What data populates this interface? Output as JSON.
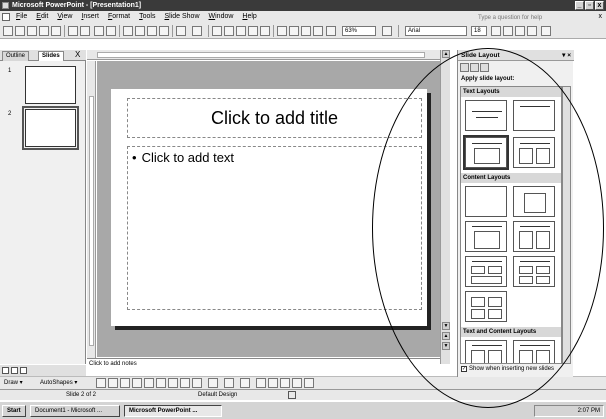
{
  "window": {
    "title": "Microsoft PowerPoint - [Presentation1]",
    "buttons": [
      "_",
      "▫",
      "x"
    ]
  },
  "menubar": {
    "items": [
      "File",
      "Edit",
      "View",
      "Insert",
      "Format",
      "Tools",
      "Slide Show",
      "Window",
      "Help"
    ],
    "ask_placeholder": "Type a question for help",
    "close": "x"
  },
  "toolbar": {
    "zoom": "63%",
    "font": "Arial",
    "font_size": "18"
  },
  "panel_tabs": {
    "outline": "Outline",
    "slides": "Slides",
    "close": "X"
  },
  "thumbnails": [
    {
      "num": "1"
    },
    {
      "num": "2"
    }
  ],
  "slide": {
    "title_placeholder": "Click to add title",
    "body_placeholder": "Click to add text",
    "bullet": "•"
  },
  "notes": {
    "placeholder": "Click to add notes"
  },
  "drawing_toolbar": {
    "draw": "Draw ▾",
    "autoshapes": "AutoShapes ▾"
  },
  "statusbar": {
    "slide": "Slide 2 of 2",
    "design": "Default Design"
  },
  "taskbar": {
    "start": "Start",
    "tasks": [
      "Document1 - Microsoft ...",
      "Microsoft PowerPoint ..."
    ],
    "clock": "2:07 PM"
  },
  "taskpane": {
    "title": "Slide Layout",
    "apply_label": "Apply slide layout:",
    "sections": [
      "Text Layouts",
      "Content Layouts",
      "Text and Content Layouts"
    ],
    "checkbox_label": "Show when inserting new slides",
    "checkbox_checked": true
  }
}
